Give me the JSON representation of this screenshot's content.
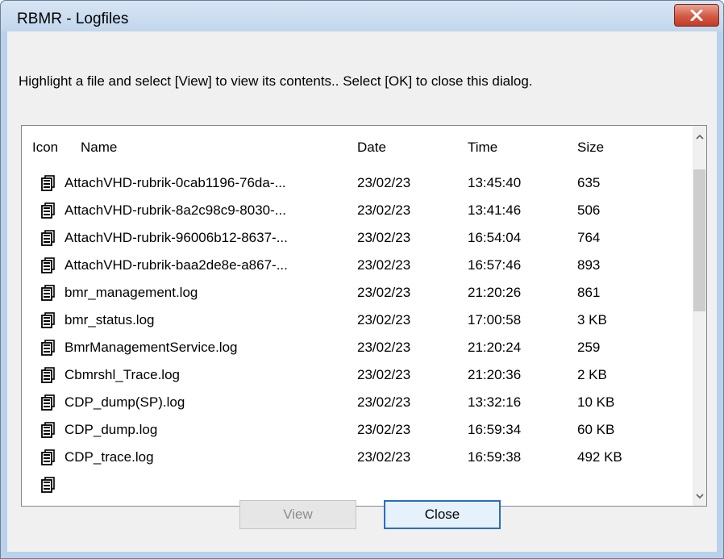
{
  "window": {
    "title": "RBMR - Logfiles",
    "close_icon": "close-x-icon"
  },
  "instruction": "Highlight a file and select [View] to view its contents.. Select [OK] to close this dialog.",
  "table": {
    "columns": [
      "Icon",
      "Name",
      "Date",
      "Time",
      "Size"
    ],
    "rows": [
      {
        "name": "AttachVHD-rubrik-0cab1196-76da-...",
        "date": "23/02/23",
        "time": "13:45:40",
        "size": "635"
      },
      {
        "name": "AttachVHD-rubrik-8a2c98c9-8030-...",
        "date": "23/02/23",
        "time": "13:41:46",
        "size": "506"
      },
      {
        "name": "AttachVHD-rubrik-96006b12-8637-...",
        "date": "23/02/23",
        "time": "16:54:04",
        "size": "764"
      },
      {
        "name": "AttachVHD-rubrik-baa2de8e-a867-...",
        "date": "23/02/23",
        "time": "16:57:46",
        "size": "893"
      },
      {
        "name": "bmr_management.log",
        "date": "23/02/23",
        "time": "21:20:26",
        "size": "861"
      },
      {
        "name": "bmr_status.log",
        "date": "23/02/23",
        "time": "17:00:58",
        "size": "3 KB"
      },
      {
        "name": "BmrManagementService.log",
        "date": "23/02/23",
        "time": "21:20:24",
        "size": "259"
      },
      {
        "name": "Cbmrshl_Trace.log",
        "date": "23/02/23",
        "time": "21:20:36",
        "size": "2 KB"
      },
      {
        "name": "CDP_dump(SP).log",
        "date": "23/02/23",
        "time": "13:32:16",
        "size": "10 KB"
      },
      {
        "name": "CDP_dump.log",
        "date": "23/02/23",
        "time": "16:59:34",
        "size": "60 KB"
      },
      {
        "name": "CDP_trace.log",
        "date": "23/02/23",
        "time": "16:59:38",
        "size": "492 KB"
      }
    ],
    "row_icon": "log-file-icon"
  },
  "buttons": {
    "view": "View",
    "close": "Close"
  },
  "colors": {
    "frame": "#b9d1ea",
    "close_button": "#c94c38",
    "focus_border": "#2c6dbf"
  }
}
